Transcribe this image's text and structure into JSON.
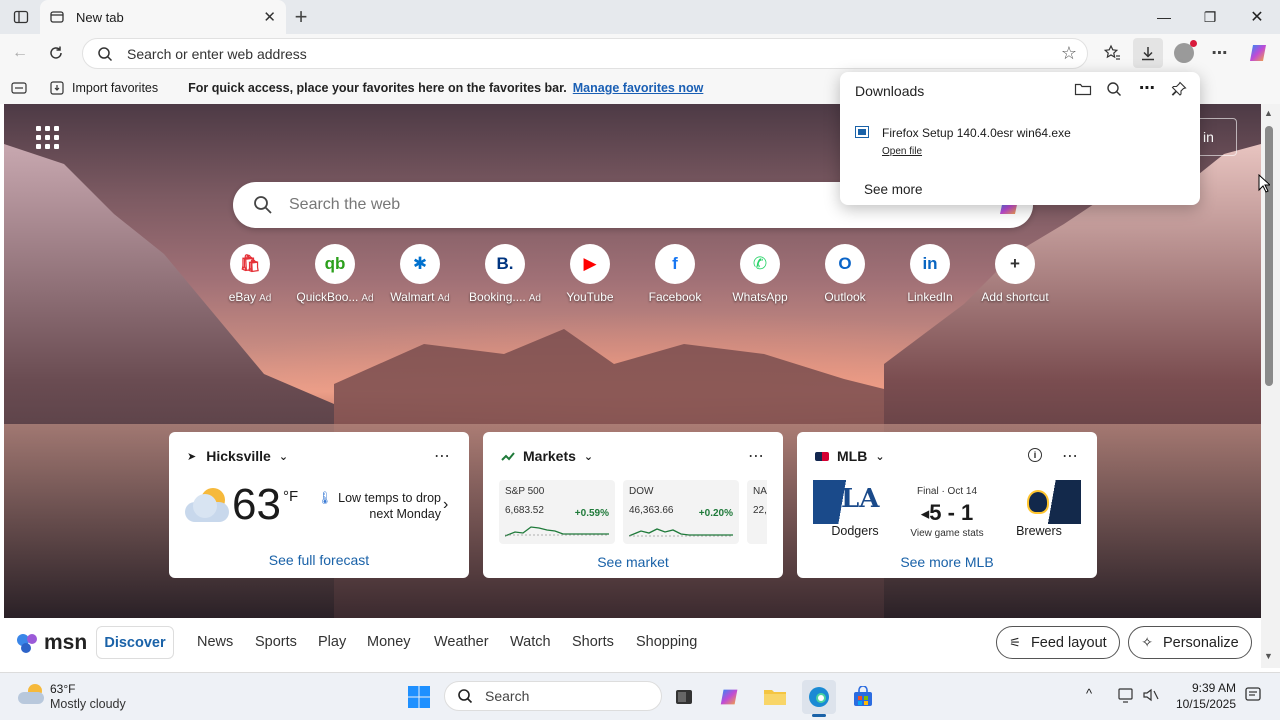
{
  "browser": {
    "tab_title": "New tab",
    "address_placeholder": "Search or enter web address"
  },
  "favbar": {
    "import_label": "Import favorites",
    "message": "For quick access, place your favorites here on the favorites bar.",
    "manage_link": "Manage favorites now"
  },
  "downloads": {
    "title": "Downloads",
    "file_name": "Firefox Setup 140.4.0esr win64.exe",
    "open_file": "Open file",
    "see_more": "See more"
  },
  "newtab": {
    "signin_partial": "in",
    "search_placeholder": "Search the web",
    "shortcuts": [
      {
        "label": "eBay",
        "ad": "Ad",
        "icon": "ebay-icon",
        "color": "#e53238",
        "glyph": "🛍"
      },
      {
        "label": "QuickBoo...",
        "ad": "Ad",
        "icon": "quickbooks-icon",
        "color": "#2ca01c",
        "glyph": "qb"
      },
      {
        "label": "Walmart",
        "ad": "Ad",
        "icon": "walmart-icon",
        "color": "#0071ce",
        "glyph": "✱"
      },
      {
        "label": "Booking....",
        "ad": "Ad",
        "icon": "booking-icon",
        "color": "#003580",
        "glyph": "B."
      },
      {
        "label": "YouTube",
        "ad": "",
        "icon": "youtube-icon",
        "color": "#ff0000",
        "glyph": "▶"
      },
      {
        "label": "Facebook",
        "ad": "",
        "icon": "facebook-icon",
        "color": "#1877f2",
        "glyph": "f"
      },
      {
        "label": "WhatsApp",
        "ad": "",
        "icon": "whatsapp-icon",
        "color": "#25d366",
        "glyph": "✆"
      },
      {
        "label": "Outlook",
        "ad": "",
        "icon": "outlook-icon",
        "color": "#0a64c8",
        "glyph": "O"
      },
      {
        "label": "LinkedIn",
        "ad": "",
        "icon": "linkedin-icon",
        "color": "#0a66c2",
        "glyph": "in"
      },
      {
        "label": "Add shortcut",
        "ad": "",
        "icon": "plus-icon",
        "color": "#333333",
        "glyph": "+"
      }
    ]
  },
  "weather_card": {
    "location": "Hicksville",
    "temp": "63",
    "unit": "°F",
    "forecast": "Low temps to drop next Monday",
    "link": "See full forecast"
  },
  "markets_card": {
    "title": "Markets",
    "items": [
      {
        "name": "S&P 500",
        "value": "6,683.52",
        "change": "+0.59%"
      },
      {
        "name": "DOW",
        "value": "46,363.66",
        "change": "+0.20%"
      },
      {
        "name": "NA",
        "value": "22,",
        "change": ""
      }
    ],
    "link": "See market"
  },
  "mlb_card": {
    "title": "MLB",
    "status": "Final · Oct 14",
    "score": "5 - 1",
    "stats": "View game stats",
    "home_team": "Dodgers",
    "away_team": "Brewers",
    "link": "See more MLB"
  },
  "msn": {
    "brand": "msn",
    "discover": "Discover",
    "nav": [
      "News",
      "Sports",
      "Play",
      "Money",
      "Weather",
      "Watch",
      "Shorts",
      "Shopping"
    ],
    "feed_layout": "Feed layout",
    "personalize": "Personalize"
  },
  "taskbar": {
    "weather_temp": "63°F",
    "weather_desc": "Mostly cloudy",
    "search": "Search",
    "time": "9:39 AM",
    "date": "10/15/2025"
  }
}
